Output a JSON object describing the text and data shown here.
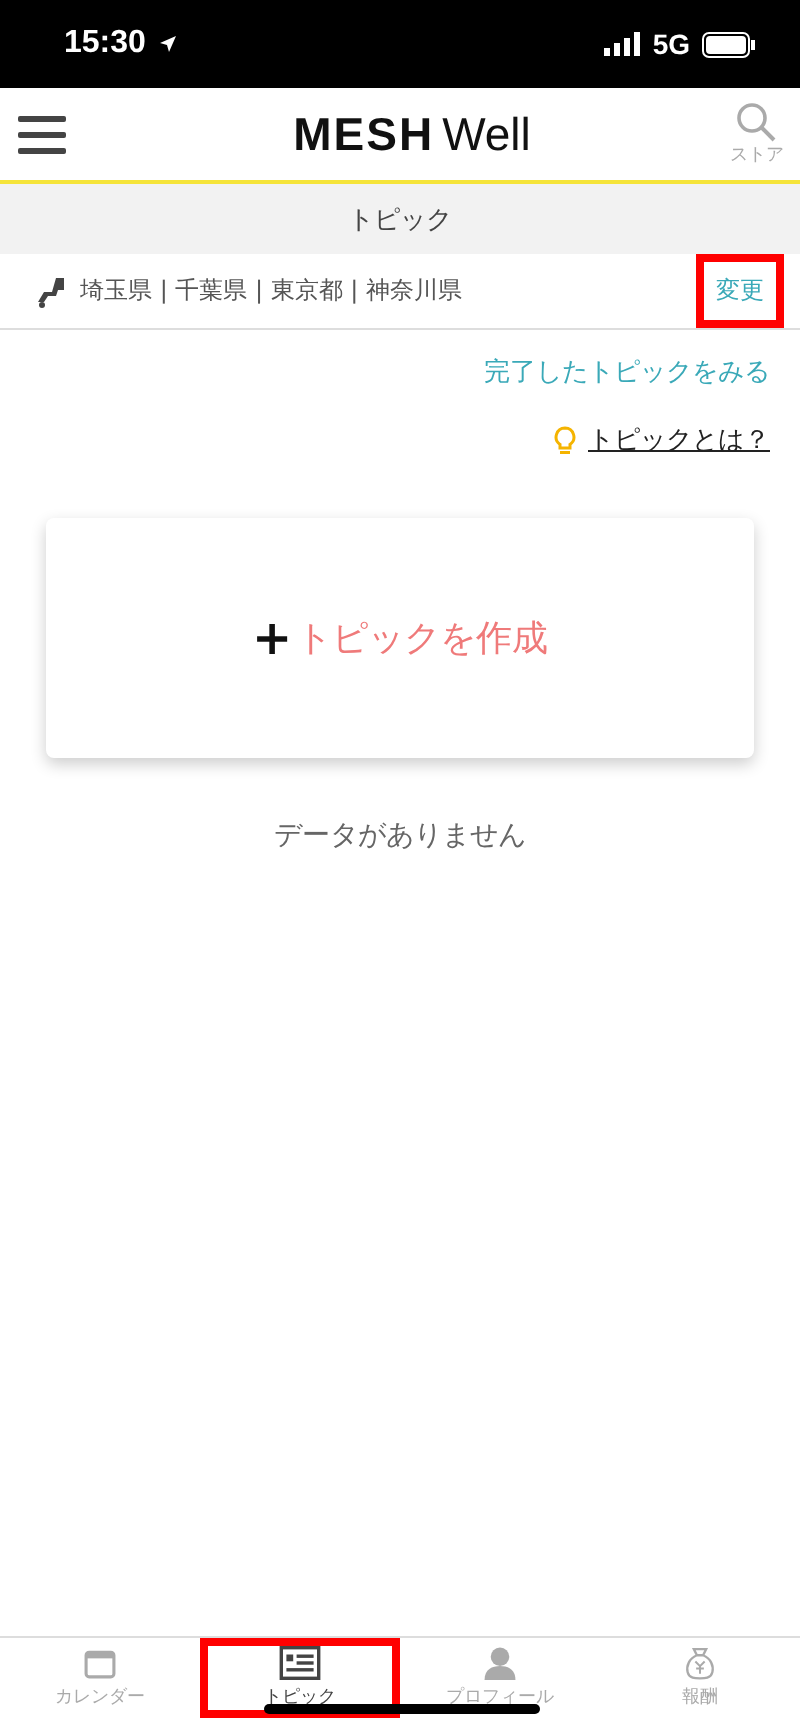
{
  "status_bar": {
    "time": "15:30",
    "network": "5G"
  },
  "header": {
    "logo_bold": "MESH",
    "logo_light": "Well",
    "store_label": "ストア"
  },
  "section_title": "トピック",
  "region": {
    "areas": "埼玉県 | 千葉県 | 東京都 | 神奈川県",
    "change_label": "変更",
    "highlighted": true
  },
  "completed_link": "完了したトピックをみる",
  "help_link": "トピックとは？",
  "create_card": {
    "plus": "+",
    "label": "トピックを作成"
  },
  "empty_message": "データがありません",
  "tab_bar": [
    {
      "kind": "calendar",
      "label": "カレンダー",
      "selected": false,
      "highlighted": false
    },
    {
      "kind": "topic",
      "label": "トピック",
      "selected": true,
      "highlighted": true
    },
    {
      "kind": "profile",
      "label": "プロフィール",
      "selected": false,
      "highlighted": false
    },
    {
      "kind": "reward",
      "label": "報酬",
      "selected": false,
      "highlighted": false
    }
  ]
}
